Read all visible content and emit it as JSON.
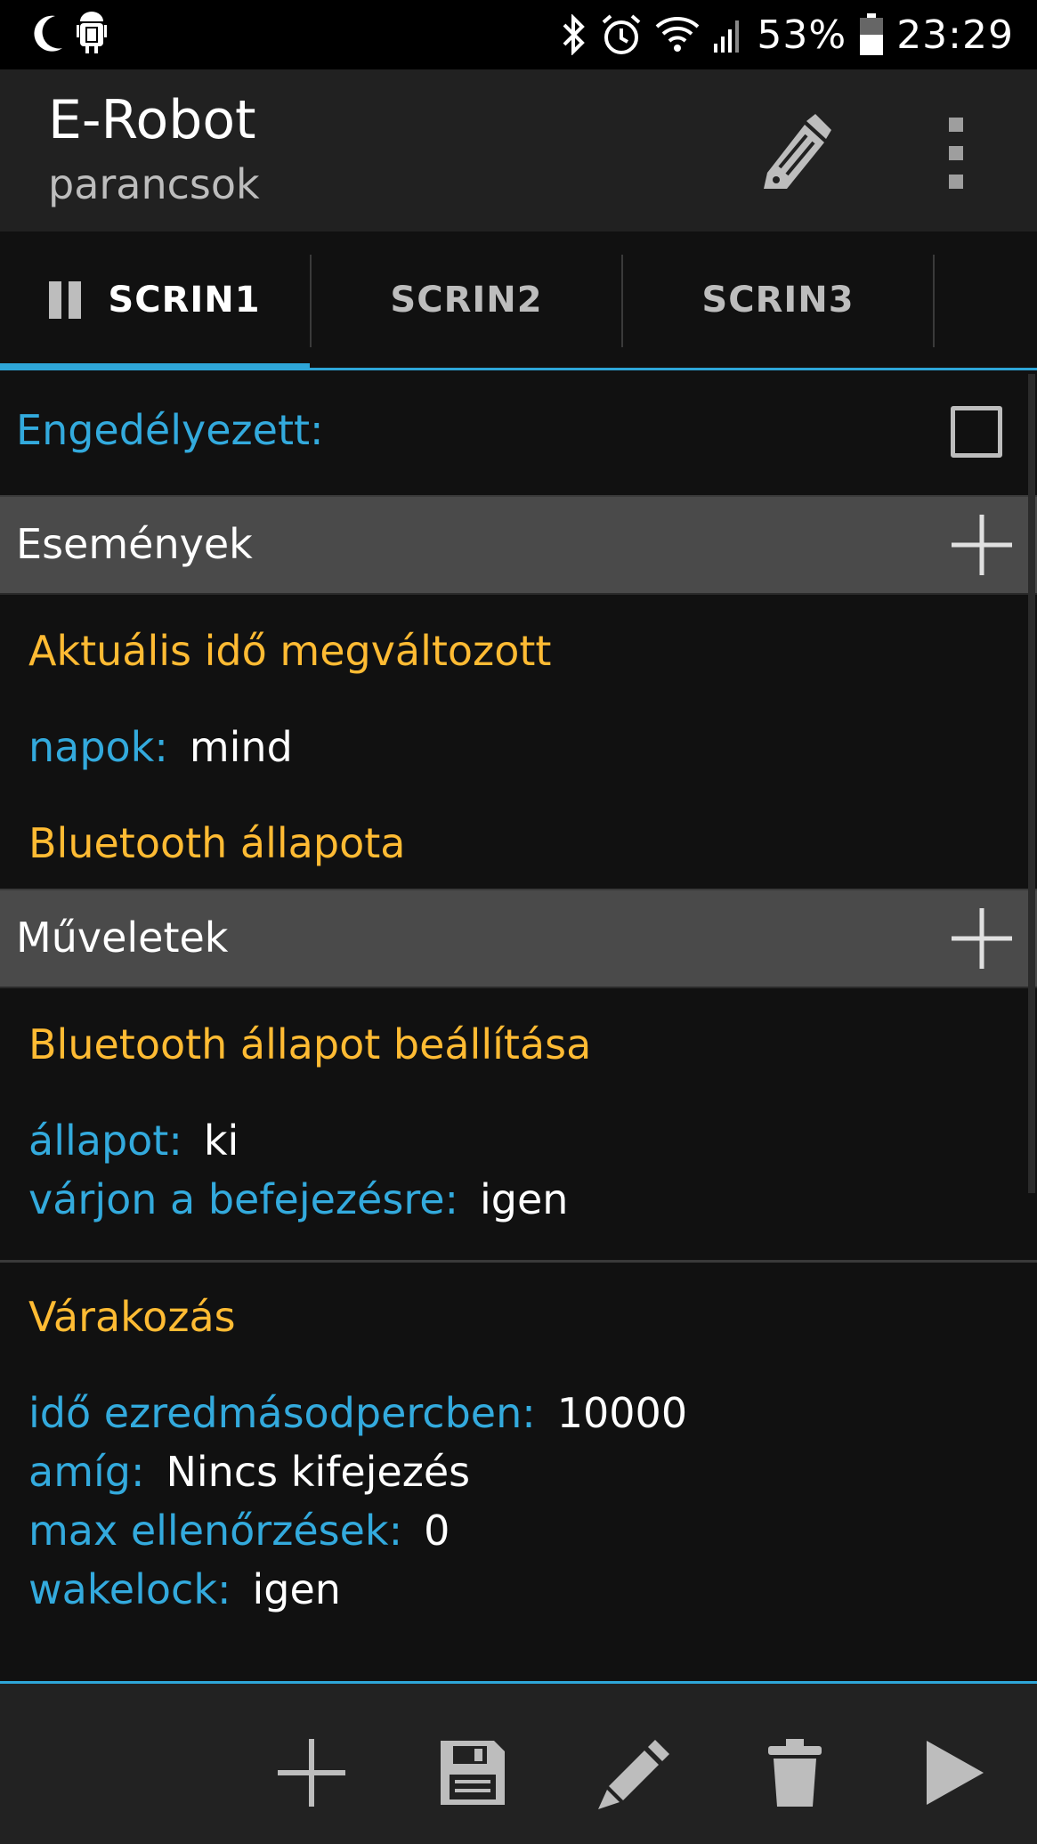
{
  "status_bar": {
    "battery": "53%",
    "time": "23:29"
  },
  "app_bar": {
    "title": "E-Robot",
    "subtitle": "parancsok"
  },
  "tabs": [
    {
      "label": "SCRIN1",
      "active": true
    },
    {
      "label": "SCRIN2",
      "active": false
    },
    {
      "label": "SCRIN3",
      "active": false
    }
  ],
  "enabled": {
    "label": "Engedélyezett:",
    "checked": false
  },
  "events": {
    "header": "Események",
    "items": [
      {
        "title": "Aktuális idő megváltozott",
        "params": [
          {
            "key": "napok:",
            "value": "mind"
          }
        ]
      },
      {
        "title": "Bluetooth állapota",
        "params": []
      }
    ]
  },
  "actions": {
    "header": "Műveletek",
    "items": [
      {
        "title": "Bluetooth állapot beállítása",
        "params": [
          {
            "key": "állapot:",
            "value": "ki"
          },
          {
            "key": "várjon a befejezésre:",
            "value": "igen"
          }
        ]
      },
      {
        "title": "Várakozás",
        "params": [
          {
            "key": "idő ezredmásodpercben:",
            "value": "10000"
          },
          {
            "key": "amíg:",
            "value": "Nincs kifejezés"
          },
          {
            "key": "max ellenőrzések:",
            "value": "0"
          },
          {
            "key": "wakelock:",
            "value": "igen"
          }
        ]
      }
    ]
  },
  "bottom_bar": {
    "icons": [
      "plus-icon",
      "save-icon",
      "pencil-icon",
      "trash-icon",
      "play-icon"
    ]
  },
  "colors": {
    "accent": "#2ea6d8",
    "key_blue": "#33aadd",
    "title_orange": "#ffbb33",
    "section_bg": "#4a4a4a",
    "background": "#111111"
  }
}
